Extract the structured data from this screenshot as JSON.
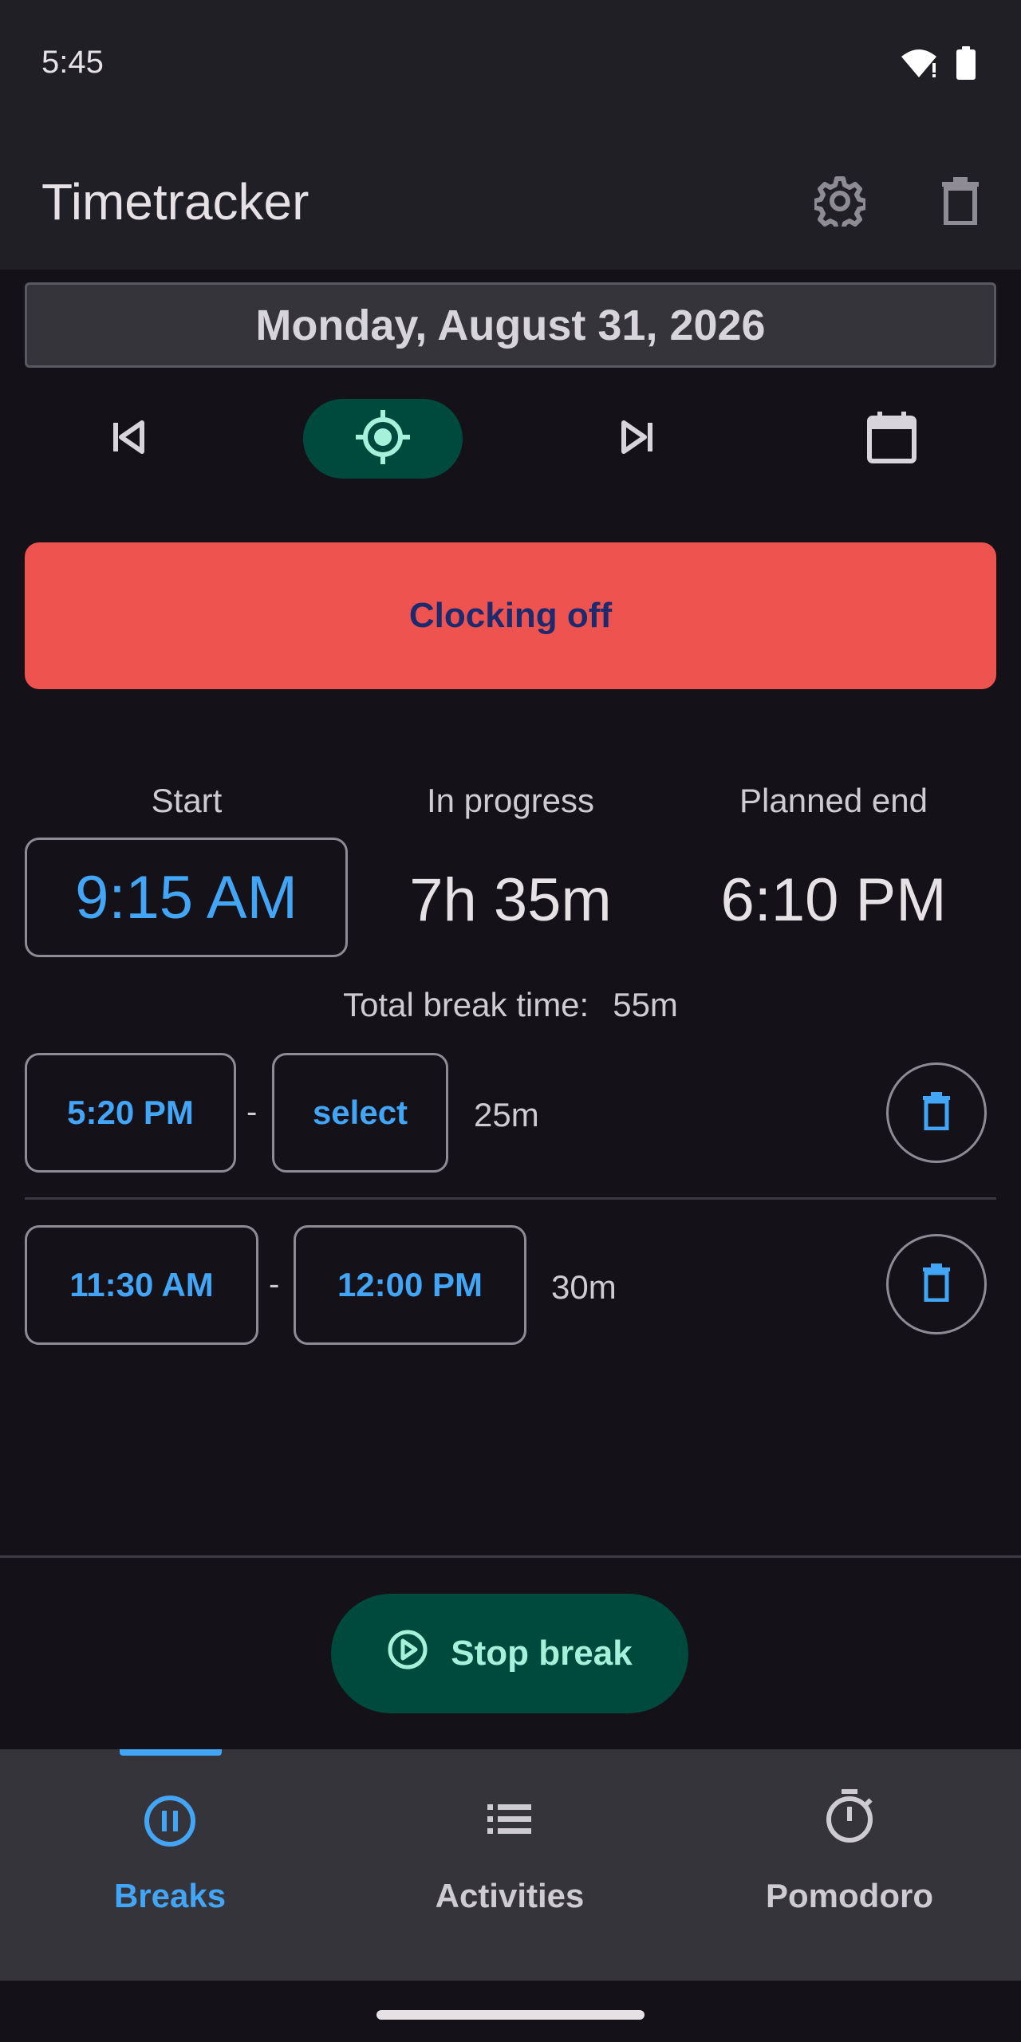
{
  "status_bar": {
    "time": "5:45"
  },
  "app_bar": {
    "title": "Timetracker"
  },
  "date": {
    "label": "Monday, August 31, 2026"
  },
  "clock_off": {
    "label": "Clocking off"
  },
  "stats": {
    "start_label": "Start",
    "start_value": "9:15 AM",
    "progress_label": "In progress",
    "progress_value": "7h 35m",
    "end_label": "Planned end",
    "end_value": "6:10 PM"
  },
  "breaks": {
    "total_label": "Total break time:",
    "total_value": "55m",
    "items": [
      {
        "start": "5:20 PM",
        "end": "select",
        "separator": "-",
        "duration": "25m"
      },
      {
        "start": "11:30 AM",
        "end": "12:00 PM",
        "separator": "-",
        "duration": "30m"
      }
    ]
  },
  "action": {
    "stop_break_label": "Stop break"
  },
  "bottom_nav": {
    "items": [
      {
        "label": "Breaks",
        "icon": "pause-circle-icon",
        "selected": true
      },
      {
        "label": "Activities",
        "icon": "list-icon",
        "selected": false
      },
      {
        "label": "Pomodoro",
        "icon": "timer-icon",
        "selected": false
      }
    ]
  },
  "colors": {
    "accent": "#42a5f5",
    "clock_off_bg": "#ef5350",
    "teal_button": "#00493d",
    "background": "#141218"
  }
}
